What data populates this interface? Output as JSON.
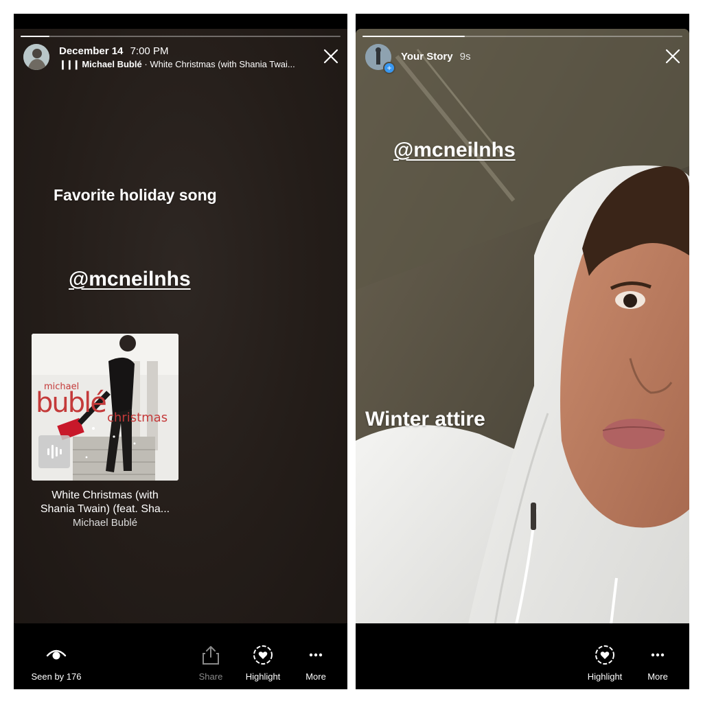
{
  "left_story": {
    "date": "December 14",
    "time": "7:00 PM",
    "music_artist": "Michael Bublé",
    "music_title": "White Christmas (with Shania Twai...",
    "sticker_text": "Favorite holiday song",
    "mention": "@mcneilnhs",
    "album": {
      "cover_artist_first": "michael",
      "cover_artist_last": "bublé",
      "cover_title": "christmas",
      "song_line1": "White Christmas (with",
      "song_line2": "Shania Twain) (feat. Sha...",
      "artist": "Michael Bublé"
    },
    "progress": 0.09,
    "actions": {
      "seen": "Seen by 176",
      "share": "Share",
      "highlight": "Highlight",
      "more": "More"
    }
  },
  "right_story": {
    "user": "Your Story",
    "elapsed": "9s",
    "mention": "@mcneilnhs",
    "caption": "Winter attire",
    "progress": 0.32,
    "actions": {
      "highlight": "Highlight",
      "more": "More"
    }
  },
  "colors": {
    "story_bg_left": "#241d19",
    "hoodie": "#f2f2f0",
    "bar": "#000000"
  }
}
